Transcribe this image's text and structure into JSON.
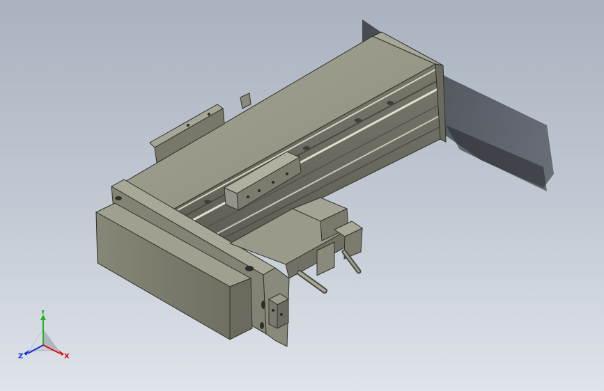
{
  "triad": {
    "x_label": "X",
    "y_label": "Y",
    "z_label": "Z",
    "x_color": "#d01010",
    "y_color": "#20b020",
    "z_color": "#1030d0"
  },
  "model": {
    "body_color": "#8c8c7c",
    "shadow_color": "#3c3f45"
  }
}
